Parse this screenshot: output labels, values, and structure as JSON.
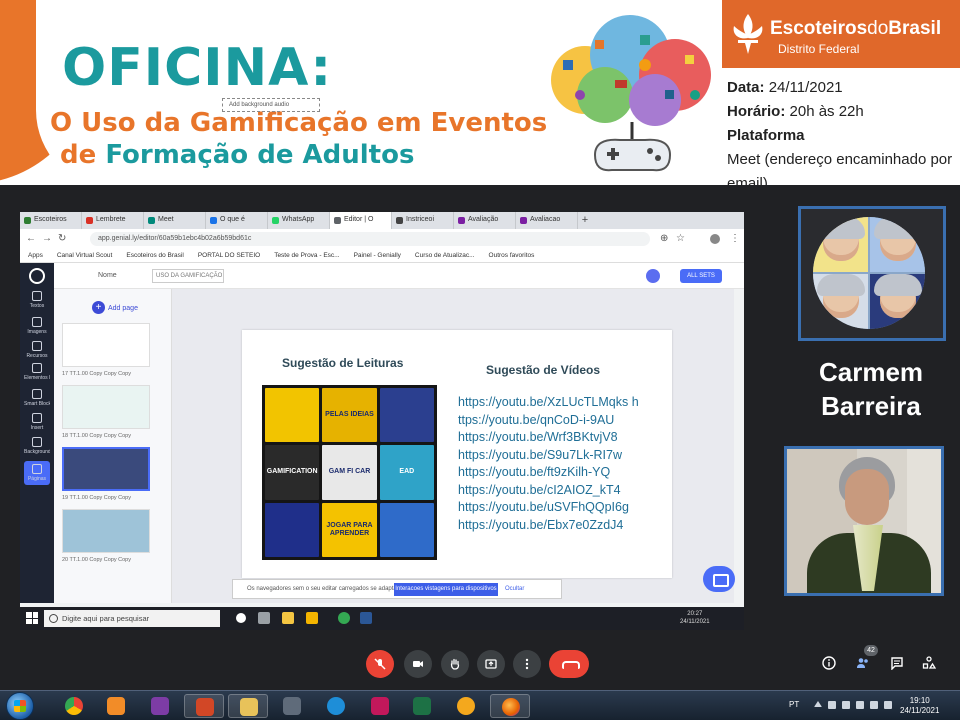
{
  "banner": {
    "title": "OFICINA:",
    "subtitle_line1": "O Uso da Gamificação em Eventos",
    "subtitle_line2_prefix": "de",
    "subtitle_line2_main": "Formação de Adultos",
    "org_name_bold": "Escoteiros",
    "org_name_light": "do",
    "org_name_end": "Brasil",
    "org_sub": "Distrito Federal",
    "date_label": "Data:",
    "date_value": "24/11/2021",
    "time_label": "Horário:",
    "time_value": "20h às 22h",
    "platform_label": "Plataforma",
    "platform_value": "Meet (endereço encaminhado por email)"
  },
  "browser": {
    "tabs": [
      {
        "label": "Escoteiros",
        "color": "#2e7d32"
      },
      {
        "label": "Lembrete",
        "color": "#d93025"
      },
      {
        "label": "Meet",
        "color": "#00897b"
      },
      {
        "label": "O que é",
        "color": "#1a73e8"
      },
      {
        "label": "WhatsApp",
        "color": "#25d366"
      },
      {
        "label": "Editor | O",
        "color": "#5f6368"
      },
      {
        "label": "Instriceoi",
        "color": "#444"
      },
      {
        "label": "Avaliação",
        "color": "#7b1fa2"
      },
      {
        "label": "Avaliacao",
        "color": "#7b1fa2"
      }
    ],
    "new_tab": "+",
    "url": "app.genial.ly/editor/60a59b1ebc4b02a6b59bd61c",
    "bookmarks": [
      "Apps",
      "Canal Virtual Scout",
      "Escoteiros do Brasil",
      "PORTAL DO SETEIO",
      "Teste de Prova - Esc...",
      "Painel - Genially",
      "Curso de Atualizac...",
      "Outros favoritos"
    ]
  },
  "editor": {
    "name_label": "Nome",
    "doc_name": "USO DA GAMIFICAÇÃO E",
    "share_label": "ALL SETS",
    "rail": [
      "Textos",
      "Imagens",
      "Recursos",
      "Elementos Interativos",
      "Smart Blocks",
      "Insert",
      "Background",
      "Páginas"
    ],
    "add_page": "Add page",
    "thumb_labels": [
      "17 TT.1.00 Copy Copy Copy",
      "18 TT.1.00 Copy Copy Copy",
      "19 TT.1.00 Copy Copy Copy",
      "20 TT.1.00 Copy Copy Copy"
    ],
    "add_background": "Add background audio",
    "notif_text": "Os navegadores sem o seu editar carregados se adaptar",
    "notif_button": "Interacoes vistagens para dispositivos",
    "notif_dismiss": "Ocultar"
  },
  "slide": {
    "heading_left": "Sugestão de Leituras",
    "heading_right": "Sugestão de Vídeos",
    "books": [
      {
        "label": "",
        "color": "#f2c400"
      },
      {
        "label": "PELAS IDEIAS",
        "color": "#e6b200"
      },
      {
        "label": "",
        "color": "#2b3f8f"
      },
      {
        "label": "GAMIFICATION",
        "color": "#2a2a2a"
      },
      {
        "label": "GAM FI CAR",
        "color": "#e8e8e8"
      },
      {
        "label": "EAD",
        "color": "#2fa3c8"
      },
      {
        "label": "",
        "color": "#1f2f8a"
      },
      {
        "label": "JOGAR PARA APRENDER",
        "color": "#f4c200"
      },
      {
        "label": "",
        "color": "#2f6bc9"
      }
    ],
    "links": [
      "https://youtu.be/XzLUcTLMqks h",
      "ttps://youtu.be/qnCoD-i-9AU",
      "https://youtu.be/Wrf3BKtvjV8",
      "https://youtu.be/S9u7Lk-RI7w",
      "https://youtu.be/ft9zKilh-YQ",
      "https://youtu.be/cI2AIOZ_kT4",
      "https://youtu.be/uSVFhQQpI6g",
      "https://youtu.be/Ebx7e0ZzdJ4"
    ]
  },
  "win_taskbar": {
    "search_placeholder": "Digite aqui para pesquisar",
    "clock_time": "20:27",
    "clock_date": "24/11/2021"
  },
  "participants": {
    "name_line1": "Carmem",
    "name_line2": "Barreira"
  },
  "meet_controls": {
    "participant_count": "42"
  },
  "win7": {
    "lang": "PT",
    "time": "19:10",
    "date": "24/11/2021"
  },
  "colors": {
    "accent_teal": "#1b9a9e",
    "accent_orange": "#e8752a",
    "meet_red": "#ea4335",
    "tile_border": "#3a6fb0"
  }
}
